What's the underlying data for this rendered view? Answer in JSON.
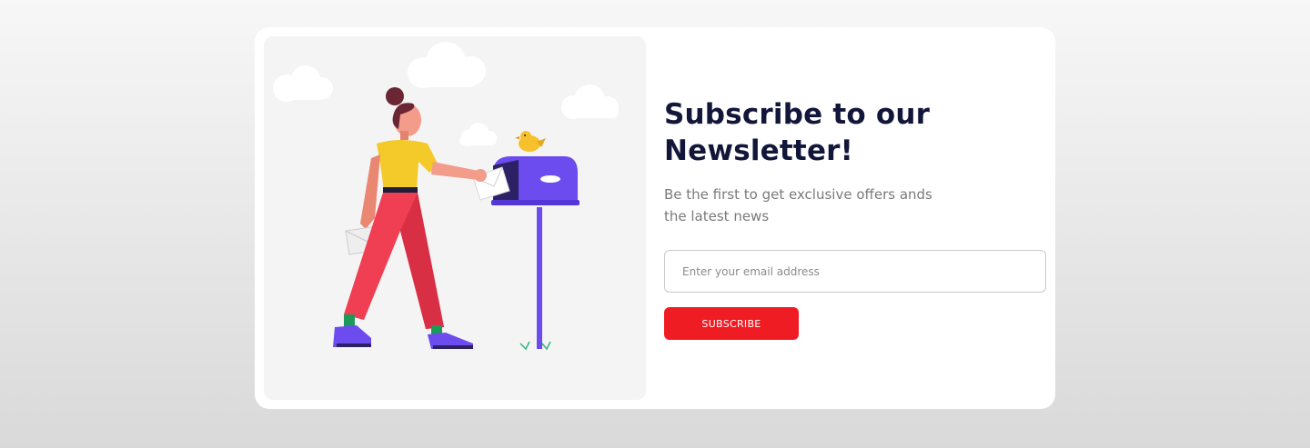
{
  "newsletter": {
    "title": "Subscribe to our Newsletter!",
    "subtitle": "Be the first to get exclusive offers ands the latest news",
    "email_placeholder": "Enter your email address",
    "email_value": "",
    "subscribe_label": "SUBSCRIBE"
  },
  "colors": {
    "accent": "#f01c23",
    "title": "#12173a",
    "mailbox": "#6c4bef",
    "illustration_bg": "#f4f4f4"
  },
  "illustration": {
    "icon": "woman-posting-letter-illustration"
  }
}
